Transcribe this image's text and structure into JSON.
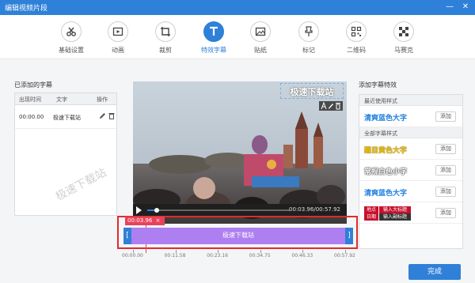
{
  "window": {
    "title": "编辑视频片段",
    "min_label": "—",
    "close_label": "✕"
  },
  "toolbar": {
    "tabs": [
      {
        "label": "基础设置",
        "icon": "scissors-icon"
      },
      {
        "label": "动画",
        "icon": "animation-icon"
      },
      {
        "label": "裁剪",
        "icon": "crop-icon"
      },
      {
        "label": "特效字幕",
        "icon": "text-icon",
        "active": true
      },
      {
        "label": "贴纸",
        "icon": "sticker-icon"
      },
      {
        "label": "标记",
        "icon": "pin-icon"
      },
      {
        "label": "二维码",
        "icon": "qrcode-icon"
      },
      {
        "label": "马赛克",
        "icon": "mosaic-icon"
      }
    ]
  },
  "left": {
    "title": "已添加的字幕",
    "headers": [
      "出现时间",
      "文字",
      "操作"
    ],
    "rows": [
      {
        "time": "00:00.00",
        "text": "极速下载站"
      }
    ],
    "watermark": "极速下载站"
  },
  "preview": {
    "overlay_text": "极速下载站",
    "time": "00:03.96/00:57.92",
    "progress": 0.068
  },
  "timeline": {
    "marker_time": "00:03.96",
    "clip_label": "极速下载站",
    "ticks": [
      "00:00.00",
      "00:11.58",
      "00:23.16",
      "00:34.75",
      "00:46.33",
      "00:57.92"
    ]
  },
  "right": {
    "title": "添加字幕特效",
    "recent_label": "最近使用样式",
    "all_label": "全部字幕样式",
    "add_label": "添加",
    "recent": [
      {
        "text": "清爽蓝色大字",
        "color": "#1d7fe0"
      }
    ],
    "styles": [
      {
        "text": "醒目黄色大字",
        "color": "#f2c200"
      },
      {
        "text": "常规白色小字",
        "color": "#ffffff"
      },
      {
        "text": "清爽蓝色大字",
        "color": "#1d7fe0"
      }
    ],
    "title_badge": {
      "place": "地点",
      "main": "输入大标题",
      "date": "日期",
      "sub": "输入副标题"
    }
  },
  "footer": {
    "done_label": "完成"
  }
}
